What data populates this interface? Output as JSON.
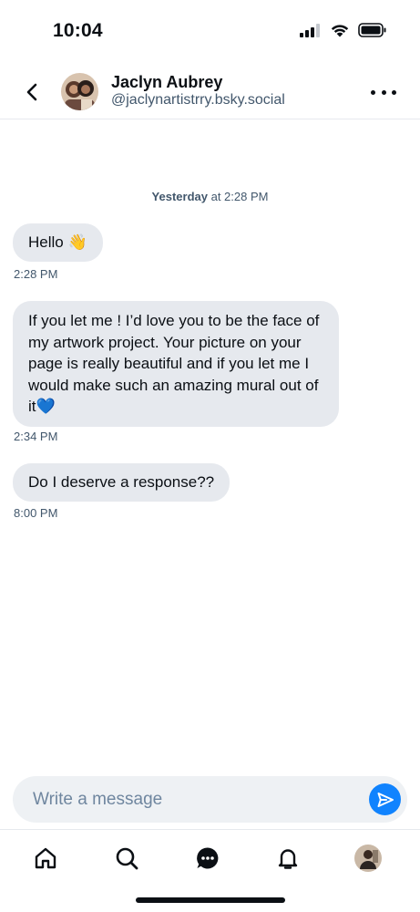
{
  "status_bar": {
    "time": "10:04"
  },
  "header": {
    "contact_name": "Jaclyn Aubrey",
    "contact_handle": "@jaclynartistrry.bsky.social",
    "back_icon": "chevron-left-icon",
    "more_icon": "ellipsis-icon"
  },
  "conversation": {
    "date_separator": {
      "day": "Yesterday",
      "time": "at 2:28 PM"
    },
    "messages": [
      {
        "text": "Hello 👋",
        "time": "2:28 PM"
      },
      {
        "text": "If you let me ! I’d love you to be the face of my artwork project. Your picture on your page is really beautiful and if you let me I would make such an amazing mural out of it💙",
        "time": "2:34 PM"
      },
      {
        "text": "Do I deserve a response??",
        "time": "8:00 PM"
      }
    ]
  },
  "composer": {
    "placeholder": "Write a message",
    "send_icon": "send-icon"
  },
  "bottom_nav": {
    "items": [
      "home-icon",
      "search-icon",
      "chat-icon",
      "bell-icon",
      "profile-avatar"
    ]
  },
  "colors": {
    "bubble_bg": "#e6e9ee",
    "accent": "#1083fe",
    "secondary_text": "#42576c"
  }
}
